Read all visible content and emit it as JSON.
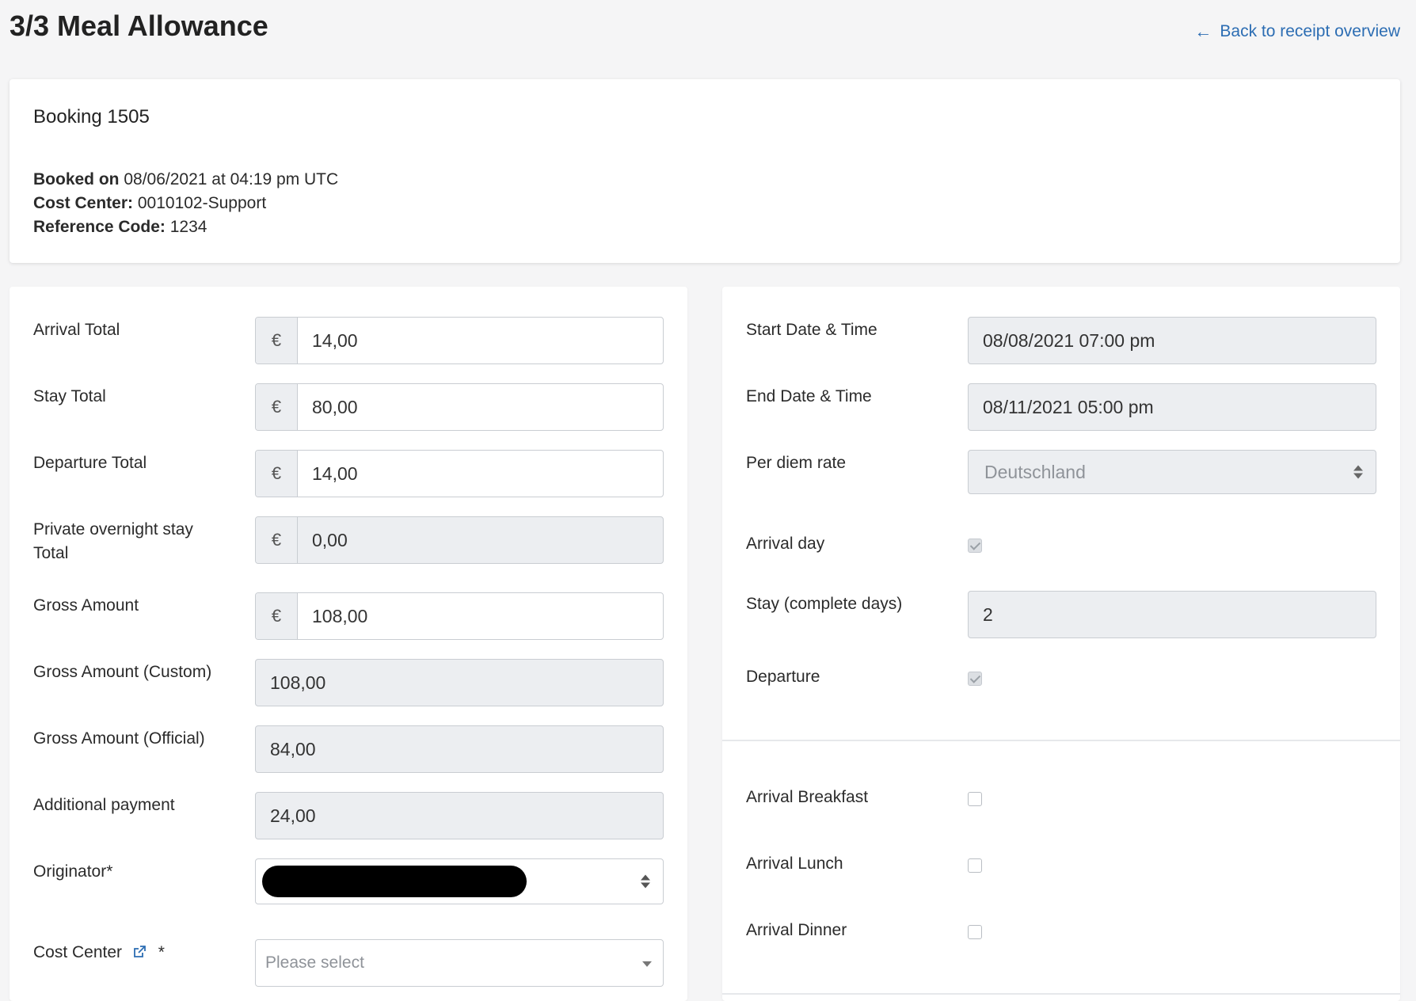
{
  "header": {
    "title": "3/3 Meal Allowance",
    "back_link": "Back to receipt overview"
  },
  "booking": {
    "title": "Booking 1505",
    "booked_on_label": "Booked on",
    "booked_on_value": "08/06/2021 at 04:19 pm UTC",
    "cost_center_label": "Cost Center:",
    "cost_center_value": "0010102-Support",
    "reference_label": "Reference Code:",
    "reference_value": "1234"
  },
  "currency_symbol": "€",
  "left": {
    "arrival_total": {
      "label": "Arrival Total",
      "value": "14,00"
    },
    "stay_total": {
      "label": "Stay Total",
      "value": "80,00"
    },
    "departure_total": {
      "label": "Departure Total",
      "value": "14,00"
    },
    "private_overnight": {
      "label_line1": "Private overnight stay",
      "label_line2": "Total",
      "value": "0,00"
    },
    "gross_amount": {
      "label": "Gross Amount",
      "value": "108,00"
    },
    "gross_custom": {
      "label": "Gross Amount (Custom)",
      "value": "108,00"
    },
    "gross_official": {
      "label": "Gross Amount (Official)",
      "value": "84,00"
    },
    "additional_payment": {
      "label": "Additional payment",
      "value": "24,00"
    },
    "originator": {
      "label": "Originator*"
    },
    "cost_center": {
      "label": "Cost Center",
      "required": "*",
      "placeholder": "Please select"
    }
  },
  "right": {
    "start_datetime": {
      "label": "Start Date & Time",
      "value": "08/08/2021 07:00 pm"
    },
    "end_datetime": {
      "label": "End Date & Time",
      "value": "08/11/2021 05:00 pm"
    },
    "per_diem_rate": {
      "label": "Per diem rate",
      "value": "Deutschland"
    },
    "arrival_day": {
      "label": "Arrival day",
      "checked": true
    },
    "stay_days": {
      "label": "Stay (complete days)",
      "value": "2"
    },
    "departure": {
      "label": "Departure",
      "checked": true
    },
    "arrival_breakfast": {
      "label": "Arrival Breakfast",
      "checked": false
    },
    "arrival_lunch": {
      "label": "Arrival Lunch",
      "checked": false
    },
    "arrival_dinner": {
      "label": "Arrival Dinner",
      "checked": false
    }
  },
  "colors": {
    "link": "#2c6db3",
    "readonly_bg": "#eceef1",
    "border": "#c9cdd2"
  }
}
